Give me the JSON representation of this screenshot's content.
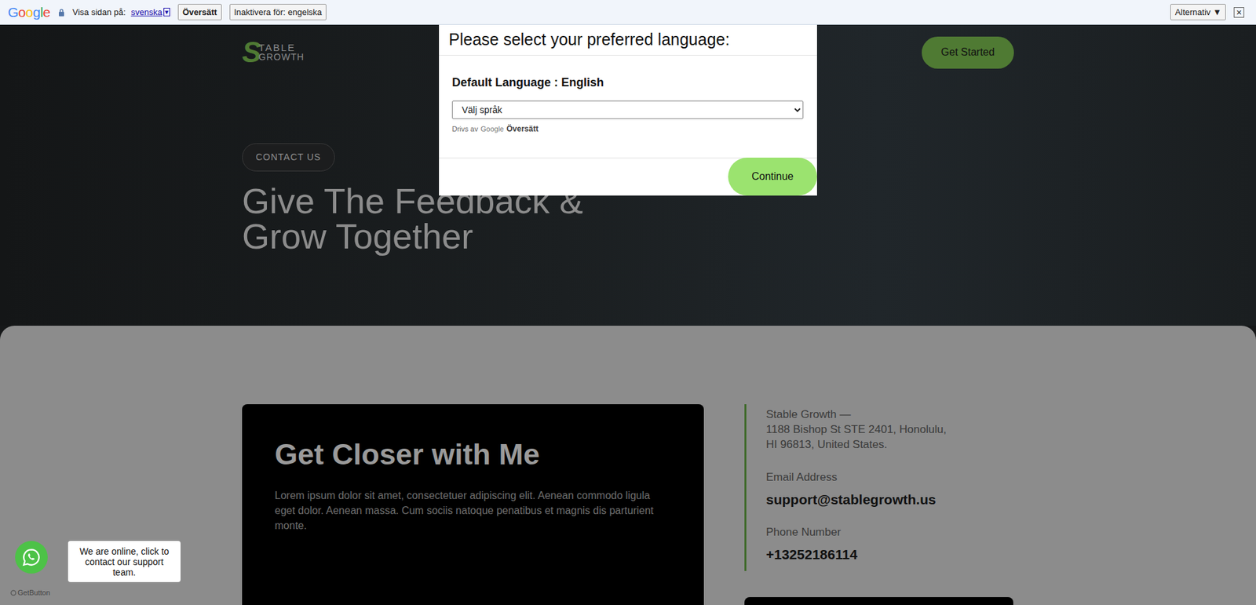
{
  "translate_bar": {
    "logo": "Google",
    "prompt": "Visa sidan på:",
    "language": "svenska",
    "dropdown_icon": "▾",
    "translate_button": "Översätt",
    "disable_button": "Inaktivera för: engelska",
    "options_button": "Alternativ ▼",
    "close_icon": "×"
  },
  "header": {
    "logo_mark": "S",
    "logo_top": "TABLE",
    "logo_bottom": "GROWTH",
    "cta": "Get Started"
  },
  "hero": {
    "badge": "CONTACT US",
    "title_lines": [
      "Give The Feedback &",
      "Grow Together"
    ]
  },
  "contact_card": {
    "title": "Get Closer with Me",
    "text": "Lorem ipsum dolor sit amet, consectetuer adipiscing elit. Aenean commodo ligula eget dolor. Aenean massa. Cum sociis natoque penatibus et magnis dis parturient monte."
  },
  "contact_info": {
    "address_lines": [
      "Stable Growth —",
      "1188 Bishop St STE 2401, Honolulu,",
      "HI 96813, United States."
    ],
    "items": [
      {
        "label": "Email Address",
        "value": "support@stablegrowth.us"
      },
      {
        "label": "Phone Number",
        "value": "+13252186114"
      }
    ]
  },
  "language_modal": {
    "title": "Please select your preferred language:",
    "default_language": "Default Language : English",
    "select_placeholder": "Välj språk",
    "powered_by": "Drivs av",
    "powered_brand": "Google",
    "powered_link": "Översätt",
    "continue": "Continue"
  },
  "chat_widget": {
    "bubble": "We are online, click to contact our support team.",
    "credit": "GetButton"
  }
}
